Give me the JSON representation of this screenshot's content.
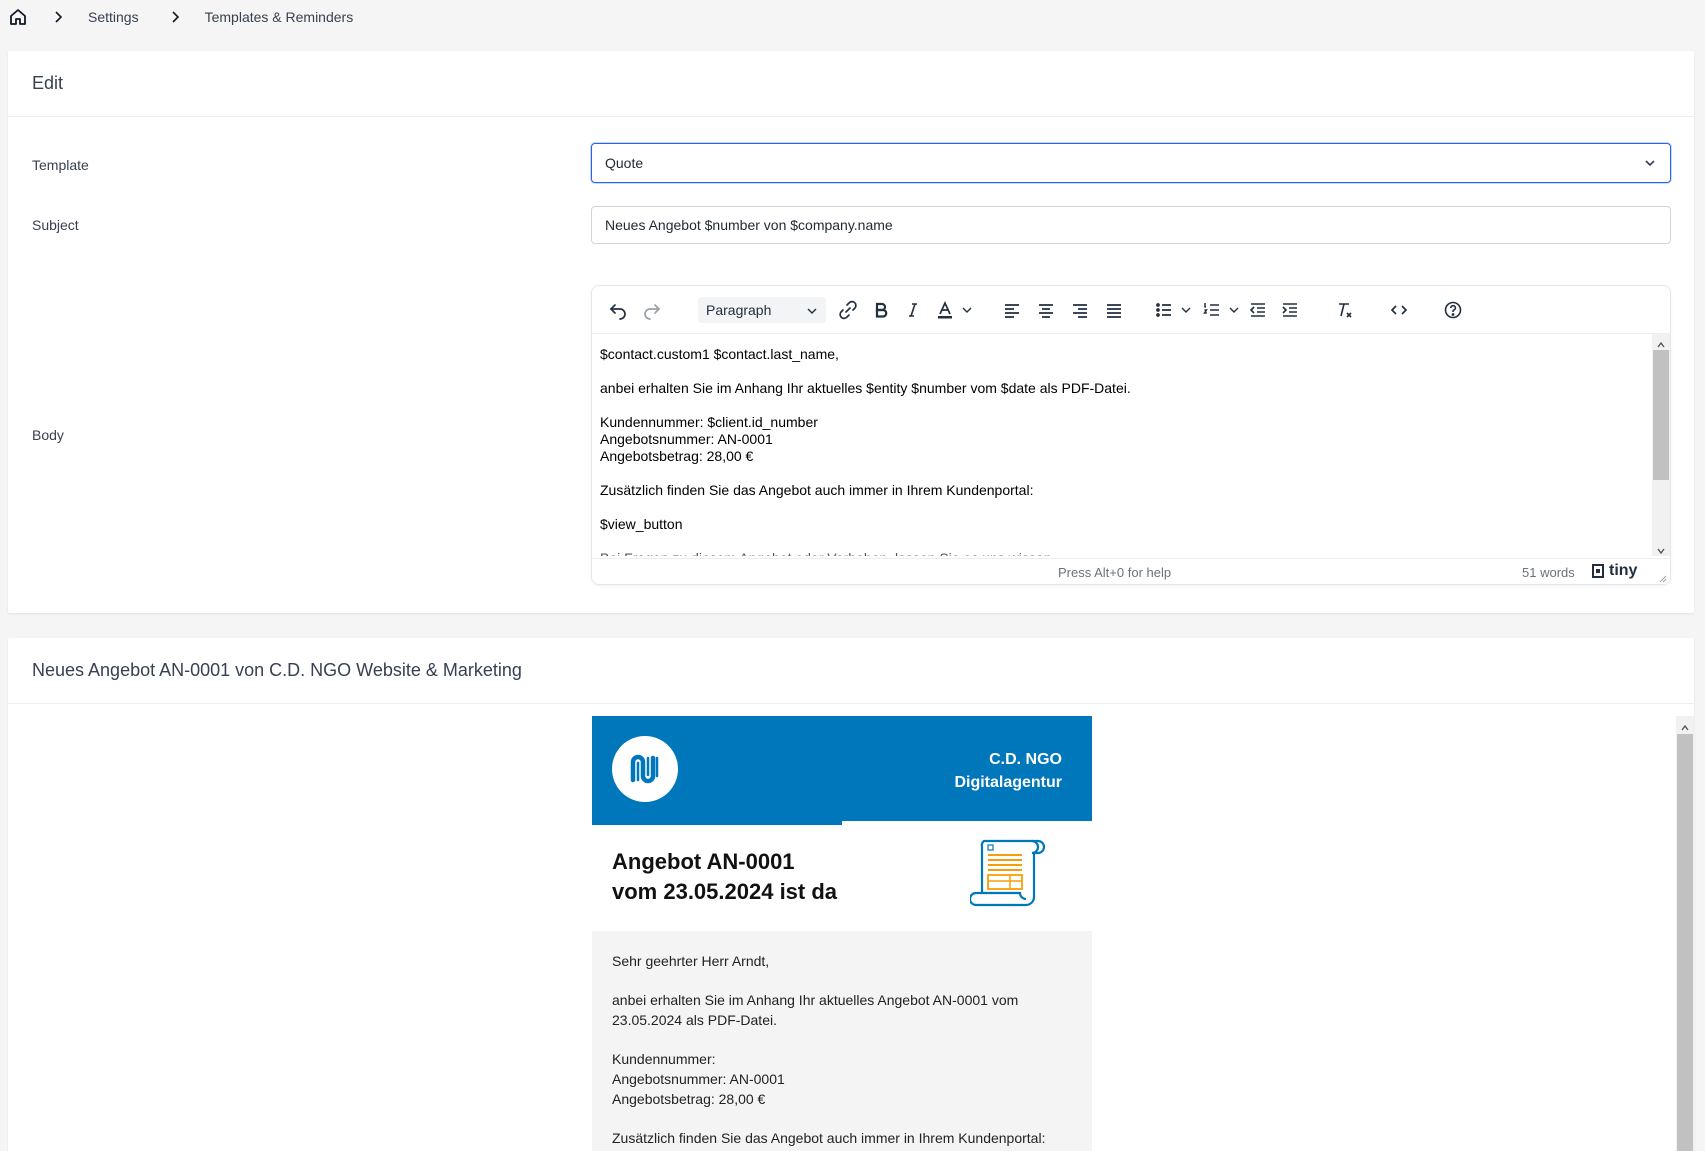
{
  "breadcrumb": {
    "items": [
      "Settings",
      "Templates & Reminders"
    ]
  },
  "edit_card": {
    "title": "Edit",
    "template_label": "Template",
    "template_value": "Quote",
    "subject_label": "Subject",
    "subject_value": "Neues Angebot $number von $company.name",
    "body_label": "Body"
  },
  "editor": {
    "block_format": "Paragraph",
    "content_lines": [
      "$contact.custom1 $contact.last_name,",
      "",
      "anbei erhalten Sie im Anhang Ihr aktuelles $entity $number vom $date als PDF-Datei.",
      "",
      "Kundennummer: $client.id_number",
      "Angebotsnummer: AN-0001",
      "Angebotsbetrag: 28,00 €",
      "",
      "Zusätzlich finden Sie das Angebot auch immer in Ihrem Kundenportal:",
      "",
      "$view_button",
      "",
      "Bei Fragen zu diesem Angebot oder Vorhaben, lassen Sie es uns wissen."
    ],
    "help_text": "Press Alt+0 for help",
    "word_count": "51 words",
    "brand": "tiny"
  },
  "preview": {
    "title": "Neues Angebot AN-0001 von C.D. NGO Website & Marketing",
    "company_line1": "C.D. NGO",
    "company_line2": "Digitalagentur",
    "hero_line1": "Angebot AN-0001",
    "hero_line2": "vom 23.05.2024 ist da",
    "body": {
      "greeting": "Sehr geehrter Herr Arndt,",
      "intro_line1": "anbei erhalten Sie im Anhang Ihr aktuelles Angebot AN-0001 vom",
      "intro_line2": "23.05.2024 als PDF-Datei.",
      "customer_number": "Kundennummer:",
      "quote_number": "Angebotsnummer: AN-0001",
      "quote_amount": "Angebotsbetrag: 28,00 €",
      "portal_line": "Zusätzlich finden Sie das Angebot auch immer in Ihrem Kundenportal:"
    }
  },
  "colors": {
    "brand_blue": "#0077bb",
    "focus_blue": "#2563eb",
    "accent_orange": "#f59e0b"
  },
  "icons": [
    "home-icon",
    "chevron-right-icon",
    "chevron-down-icon",
    "undo-icon",
    "redo-icon",
    "link-icon",
    "bold-icon",
    "italic-icon",
    "text-color-icon",
    "align-left-icon",
    "align-center-icon",
    "align-right-icon",
    "align-justify-icon",
    "bullet-list-icon",
    "numbered-list-icon",
    "outdent-icon",
    "indent-icon",
    "clear-formatting-icon",
    "source-code-icon",
    "help-icon",
    "tiny-logo-icon",
    "document-scroll-icon"
  ]
}
